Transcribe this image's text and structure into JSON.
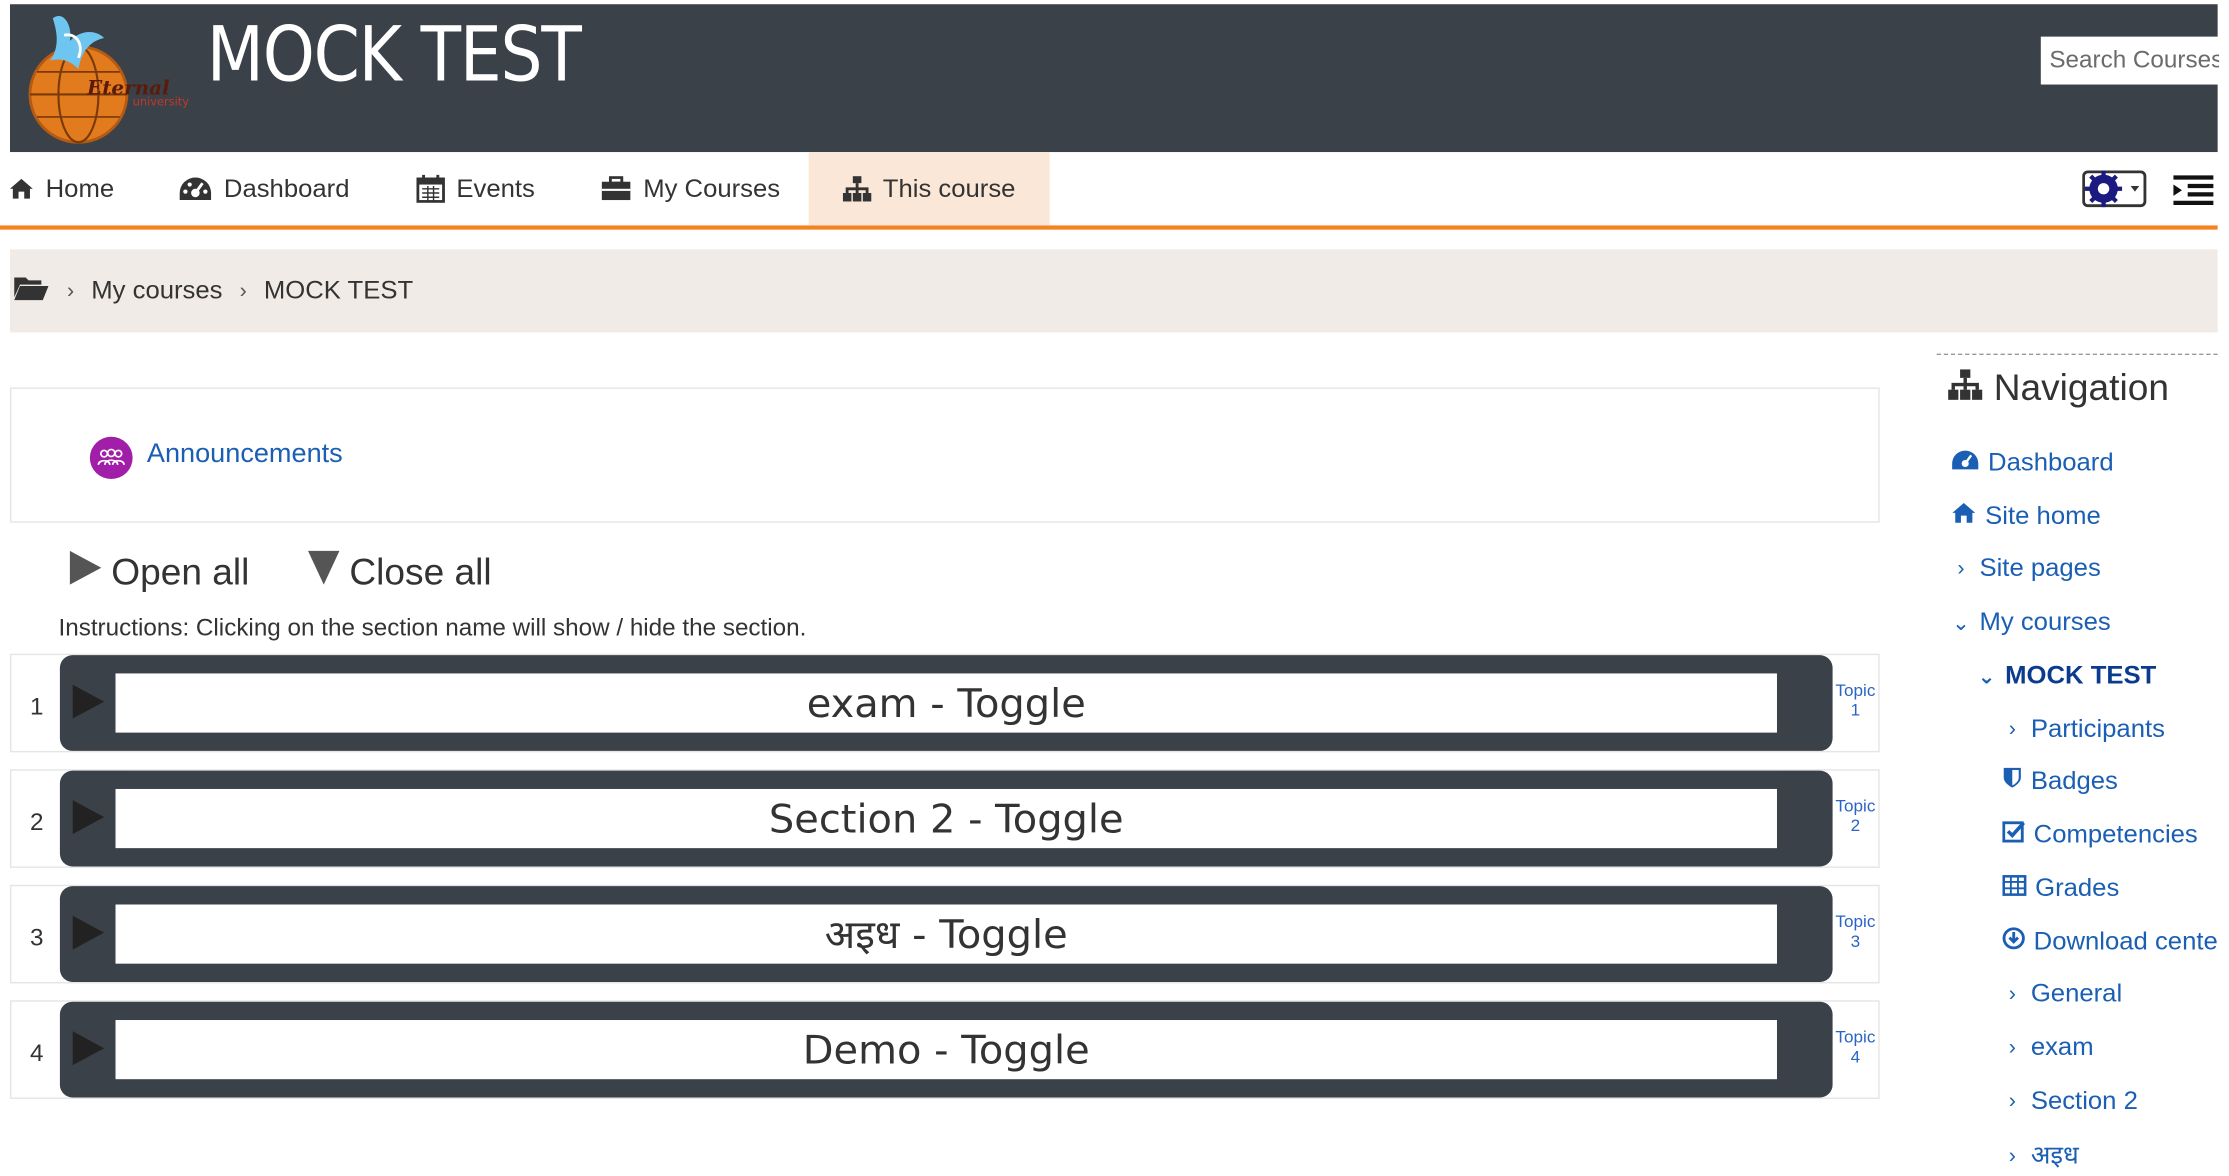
{
  "header": {
    "site_title": "MOCK TEST",
    "logo_text": "Eternal University",
    "search_placeholder": "Search Courses"
  },
  "navbar": {
    "items": [
      {
        "label": "Home",
        "icon": "home-icon"
      },
      {
        "label": "Dashboard",
        "icon": "dashboard-icon"
      },
      {
        "label": "Events",
        "icon": "calendar-icon"
      },
      {
        "label": "My Courses",
        "icon": "briefcase-icon"
      },
      {
        "label": "This course",
        "icon": "sitemap-icon",
        "active": true
      }
    ],
    "accent_color": "#f58220"
  },
  "breadcrumb": {
    "items": [
      "My courses",
      "MOCK TEST"
    ]
  },
  "main": {
    "announcements_label": "Announcements",
    "open_all_label": "Open all",
    "close_all_label": "Close all",
    "instructions": "Instructions: Clicking on the section name will show / hide the section.",
    "sections": [
      {
        "number": "1",
        "title": "exam - Toggle",
        "topic_label": "Topic",
        "topic_number": "1"
      },
      {
        "number": "2",
        "title": "Section 2 - Toggle",
        "topic_label": "Topic",
        "topic_number": "2"
      },
      {
        "number": "3",
        "title": "अइध - Toggle",
        "topic_label": "Topic",
        "topic_number": "3"
      },
      {
        "number": "4",
        "title": "Demo - Toggle",
        "topic_label": "Topic",
        "topic_number": "4"
      }
    ]
  },
  "navigation_block": {
    "title": "Navigation",
    "items": [
      {
        "label": "Dashboard",
        "icon": "dashboard-icon"
      },
      {
        "label": "Site home",
        "icon": "home-icon"
      },
      {
        "label": "Site pages",
        "icon": "chevron-right-icon"
      },
      {
        "label": "My courses",
        "icon": "chevron-down-icon"
      },
      {
        "label": "MOCK TEST",
        "icon": "chevron-down-icon"
      },
      {
        "label": "Participants",
        "icon": "chevron-right-icon"
      },
      {
        "label": "Badges",
        "icon": "shield-icon"
      },
      {
        "label": "Competencies",
        "icon": "check-square-icon"
      },
      {
        "label": "Grades",
        "icon": "table-icon"
      },
      {
        "label": "Download center",
        "icon": "download-circle-icon"
      },
      {
        "label": "General",
        "icon": "chevron-right-icon"
      },
      {
        "label": "exam",
        "icon": "chevron-right-icon"
      },
      {
        "label": "Section 2",
        "icon": "chevron-right-icon"
      },
      {
        "label": "अइध",
        "icon": "chevron-right-icon"
      }
    ]
  },
  "colors": {
    "header_bg": "#3b4148",
    "breadcrumb_bg": "#f0ebe6",
    "active_tab_bg": "#fbe7d7",
    "link": "#1a5fb4",
    "announcement_icon_bg": "#a11ea8"
  }
}
